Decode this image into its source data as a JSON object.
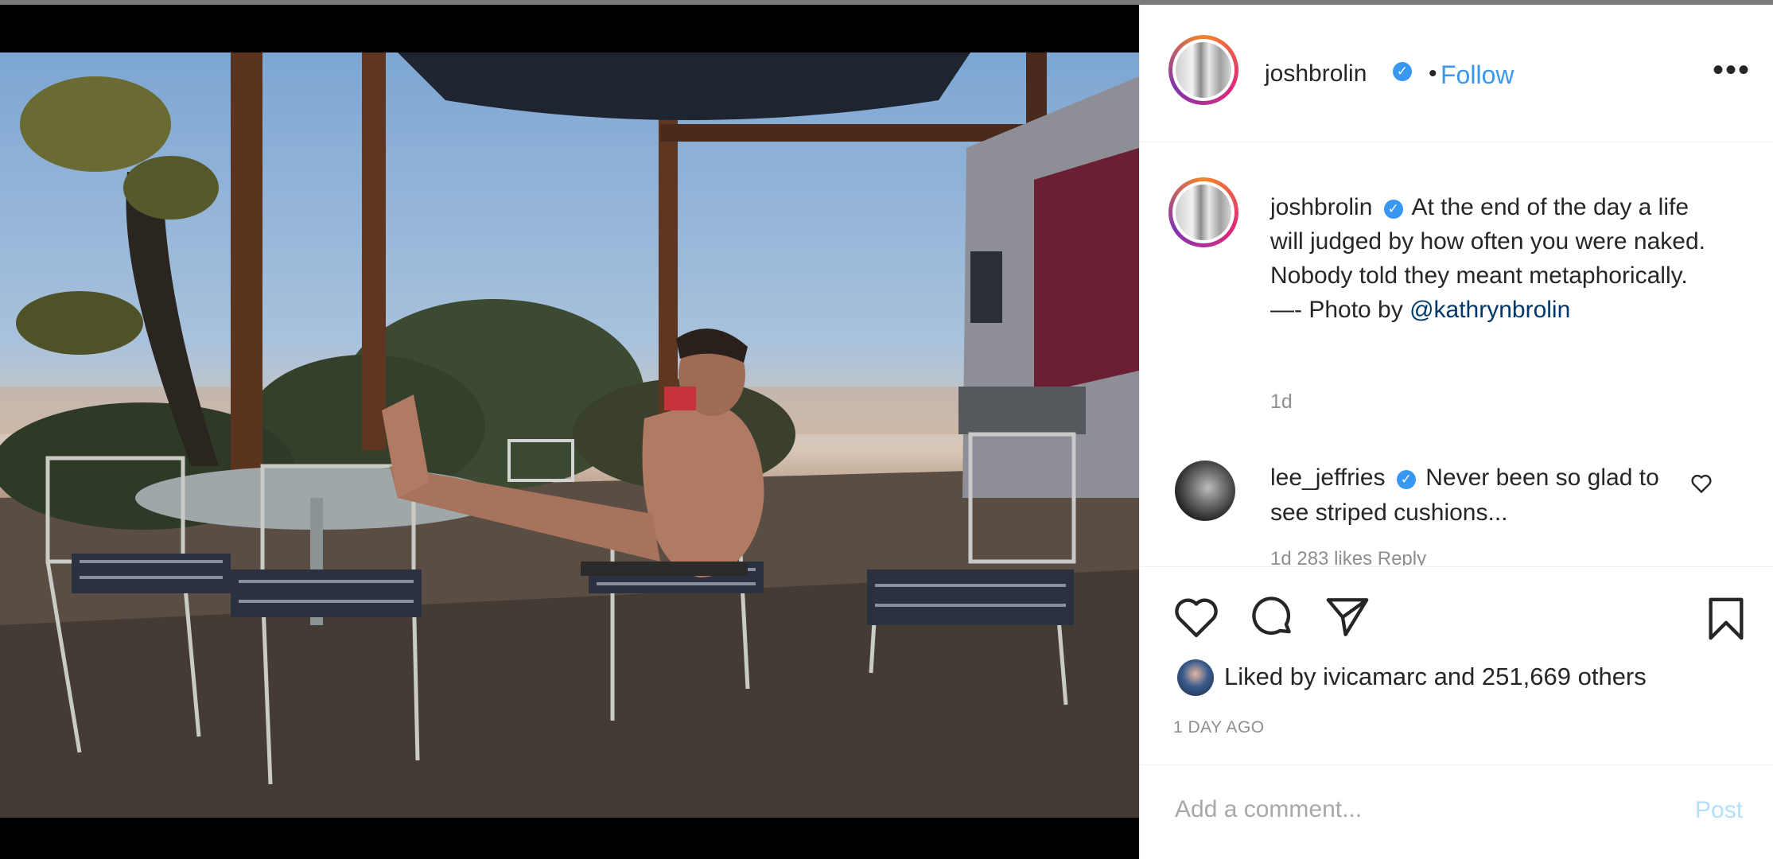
{
  "post": {
    "author": "joshbrolin",
    "follow_label": "Follow",
    "separator": "•",
    "more_label": "•••",
    "verified_glyph": "✓"
  },
  "caption": {
    "user": "joshbrolin",
    "text": "At the end of the day a life will judged by how often you were naked. Nobody told they meant metaphorically. —- Photo by ",
    "mention": "@kathrynbrolin",
    "time": "1d"
  },
  "comment": {
    "user": "lee_jeffries",
    "text": "Never been so glad to see striped cushions...",
    "meta": "1d  283 likes  Reply"
  },
  "likes": {
    "prefix": "Liked by ",
    "user": "ivicamarc",
    "suffix": " and 251,669 others"
  },
  "age": "1 DAY AGO",
  "add_comment": {
    "placeholder": "Add a comment...",
    "post_label": "Post"
  },
  "icons": {
    "like": "heart-icon",
    "comment": "comment-bubble-icon",
    "share": "paper-plane-icon",
    "save": "bookmark-icon",
    "more": "more-options-icon",
    "verified": "verified-badge-icon"
  },
  "colors": {
    "link_blue": "#3897f0",
    "mention": "#00376b",
    "muted": "#8e8e8e",
    "post_disabled": "#b2dffc",
    "border": "#efefef"
  }
}
